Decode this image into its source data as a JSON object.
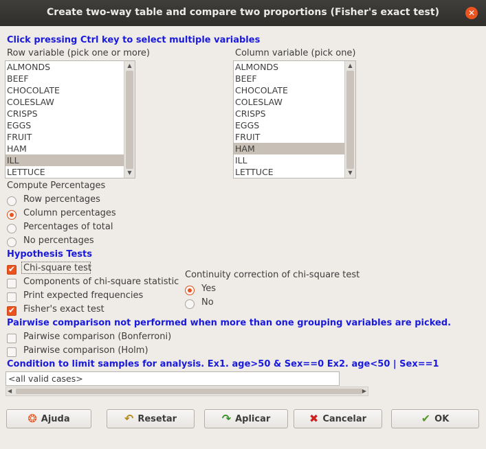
{
  "window": {
    "title": "Create two-way table and compare two proportions (Fisher's exact test)"
  },
  "instructions": "Click pressing Ctrl key to select multiple variables",
  "row_variable": {
    "label": "Row variable (pick one or more)",
    "items": [
      "ALMONDS",
      "BEEF",
      "CHOCOLATE",
      "COLESLAW",
      "CRISPS",
      "EGGS",
      "FRUIT",
      "HAM",
      "ILL",
      "LETTUCE"
    ],
    "selected": "ILL"
  },
  "column_variable": {
    "label": "Column variable (pick one)",
    "items": [
      "ALMONDS",
      "BEEF",
      "CHOCOLATE",
      "COLESLAW",
      "CRISPS",
      "EGGS",
      "FRUIT",
      "HAM",
      "ILL",
      "LETTUCE"
    ],
    "selected": "HAM"
  },
  "percentages": {
    "label": "Compute Percentages",
    "options": [
      "Row percentages",
      "Column percentages",
      "Percentages of total",
      "No percentages"
    ],
    "selected": "Column percentages"
  },
  "hypothesis": {
    "label": "Hypothesis Tests",
    "options": [
      {
        "label": "Chi-square test",
        "checked": true
      },
      {
        "label": "Components of chi-square statistic",
        "checked": false
      },
      {
        "label": "Print expected frequencies",
        "checked": false
      },
      {
        "label": "Fisher's exact test",
        "checked": true
      }
    ]
  },
  "continuity": {
    "label": "Continuity correction of chi-square test",
    "options": [
      "Yes",
      "No"
    ],
    "selected": "Yes"
  },
  "pairwise": {
    "label": "Pairwise comparison not performed when more than one grouping variables are picked.",
    "options": [
      {
        "label": "Pairwise comparison (Bonferroni)",
        "checked": false
      },
      {
        "label": "Pairwise comparison (Holm)",
        "checked": false
      }
    ]
  },
  "condition": {
    "label": "Condition to limit samples for analysis. Ex1. age>50 & Sex==0  Ex2. age<50 | Sex==1",
    "value": "<all valid cases>"
  },
  "buttons": {
    "help": "Ajuda",
    "reset": "Resetar",
    "apply": "Aplicar",
    "cancel": "Cancelar",
    "ok": "OK"
  },
  "colors": {
    "accent": "#e95420",
    "label_blue": "#1a1adb",
    "selection": "#c8c0b6"
  }
}
